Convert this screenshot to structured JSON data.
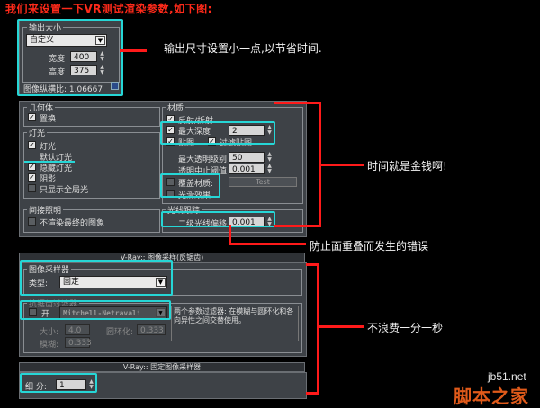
{
  "title": "我们来设置一下VR测试渲染参数,如下图:",
  "output_size": {
    "group_title": "输出大小",
    "preset": "自定义",
    "width_label": "宽度",
    "width_value": "400",
    "height_label": "高度",
    "height_value": "375",
    "aspect_label": "图像纵横比: 1.06667"
  },
  "geometry": {
    "group_title": "几何体",
    "displacement": "置换"
  },
  "lighting": {
    "group_title": "灯光",
    "lights": "灯光",
    "default_lights": "默认灯光",
    "hidden_lights": "隐藏灯光",
    "shadows": "阴影",
    "show_gi_only": "只显示全局光"
  },
  "materials": {
    "group_title": "材质",
    "reflection": "反射/折射",
    "max_depth_label": "最大深度",
    "max_depth_value": "2",
    "maps": "贴图",
    "filter_maps": "过滤贴图",
    "max_transp_label": "最大透明级别",
    "max_transp_value": "50",
    "transp_cutoff_label": "透明中止阈值",
    "transp_cutoff_value": "0.001",
    "override_mtl": "覆盖材质:",
    "override_btn": "Test",
    "glossy": "光滑效果"
  },
  "indirect": {
    "group_title": "间接照明",
    "dont_render_final": "不渲染最终的图象"
  },
  "raytrace": {
    "group_title": "光线跟踪",
    "secondary_bias_label": "二级光线偏移",
    "secondary_bias_value": "0.001"
  },
  "image_sampler_rollout": {
    "title": "V-Ray:: 图像采样(反锯齿)",
    "sampler_group": "图像采样器",
    "type_label": "类型:",
    "type_value": "固定",
    "aa_group": "抗锯齿过滤器",
    "on_label": "开",
    "filter_value": "Mitchell-Netravali",
    "filter_desc": "两个参数过滤器: 在模糊与圆环化和各向异性之间交替使用。",
    "size_label": "大小:",
    "size_value": "4.0",
    "ringing_label": "圆环化:",
    "ringing_value": "0.333",
    "blur_label": "模糊:",
    "blur_value": "0.333"
  },
  "fixed_sampler_rollout": {
    "title": "V-Ray:: 固定图像采样器",
    "subdivs_label": "细 分:",
    "subdivs_value": "1"
  },
  "annotations": {
    "output_note": "输出尺寸设置小一点,以节省时间.",
    "time_note": "时间就是金钱啊!",
    "prevent_note": "防止面重叠而发生的错误",
    "waste_note": "不浪费一分一秒"
  },
  "watermark": {
    "site": "jb51.net",
    "name": "脚本之家"
  },
  "colors": {
    "highlight": "#26d6d6",
    "arrow": "#ff1a1a",
    "title": "#ff2a1a",
    "panel": "#3e4247"
  }
}
